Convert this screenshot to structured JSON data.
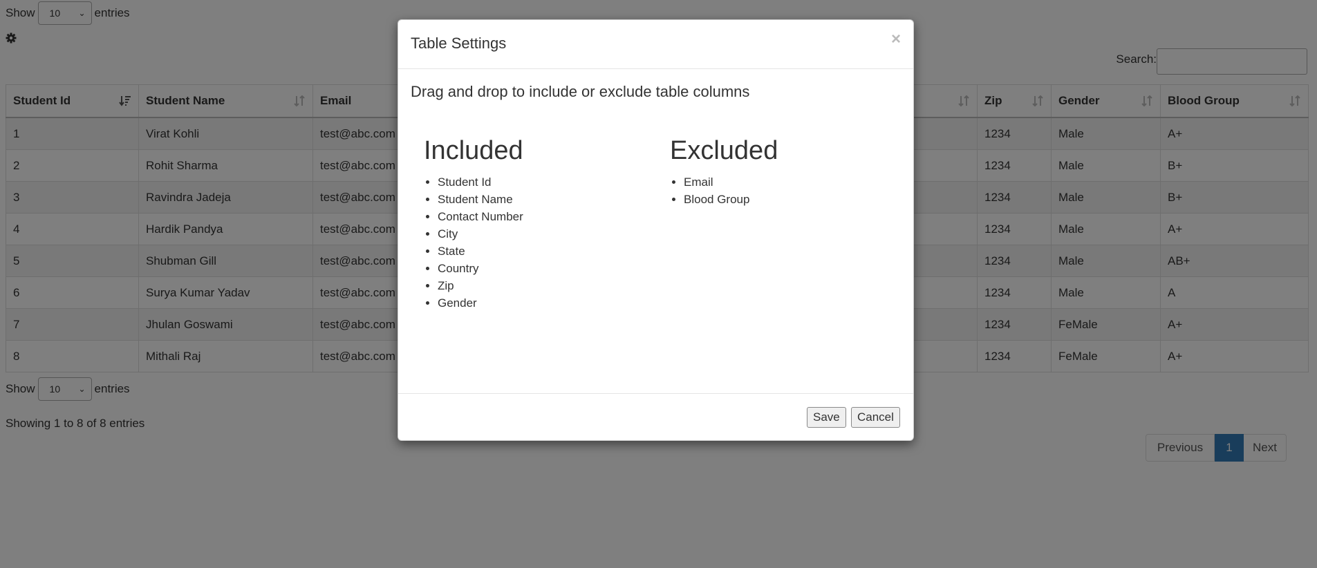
{
  "length_top": {
    "show": "Show",
    "value": "10",
    "entries": "entries"
  },
  "length_bottom": {
    "show": "Show",
    "value": "10",
    "entries": "entries"
  },
  "search": {
    "label": "Search:",
    "value": ""
  },
  "table": {
    "headers": [
      "Student Id",
      "Student Name",
      "Email",
      "",
      "",
      "",
      "",
      "Zip",
      "Gender",
      "Blood Group"
    ],
    "rows": [
      {
        "id": "1",
        "name": "Virat Kohli",
        "email": "test@abc.com",
        "zip": "1234",
        "gender": "Male",
        "blood": "A+"
      },
      {
        "id": "2",
        "name": "Rohit Sharma",
        "email": "test@abc.com",
        "zip": "1234",
        "gender": "Male",
        "blood": "B+"
      },
      {
        "id": "3",
        "name": "Ravindra Jadeja",
        "email": "test@abc.com",
        "zip": "1234",
        "gender": "Male",
        "blood": "B+"
      },
      {
        "id": "4",
        "name": "Hardik Pandya",
        "email": "test@abc.com",
        "zip": "1234",
        "gender": "Male",
        "blood": "A+"
      },
      {
        "id": "5",
        "name": "Shubman Gill",
        "email": "test@abc.com",
        "zip": "1234",
        "gender": "Male",
        "blood": "AB+"
      },
      {
        "id": "6",
        "name": "Surya Kumar Yadav",
        "email": "test@abc.com",
        "zip": "1234",
        "gender": "Male",
        "blood": "A"
      },
      {
        "id": "7",
        "name": "Jhulan Goswami",
        "email": "test@abc.com",
        "zip": "1234",
        "gender": "FeMale",
        "blood": "A+"
      },
      {
        "id": "8",
        "name": "Mithali Raj",
        "email": "test@abc.com",
        "zip": "1234",
        "gender": "FeMale",
        "blood": "A+"
      }
    ]
  },
  "info": "Showing 1 to 8 of 8 entries",
  "pagination": {
    "previous": "Previous",
    "current": "1",
    "next": "Next"
  },
  "modal": {
    "title": "Table Settings",
    "close": "×",
    "intro": "Drag and drop to include or exclude table columns",
    "included_title": "Included",
    "included": [
      "Student Id",
      "Student Name",
      "Contact Number",
      "City",
      "State",
      "Country",
      "Zip",
      "Gender"
    ],
    "excluded_title": "Excluded",
    "excluded": [
      "Email",
      "Blood Group"
    ],
    "save": "Save",
    "cancel": "Cancel"
  },
  "colors": {
    "pagination_active": "#337ab7",
    "backdrop": "rgba(0,0,0,0.5)"
  }
}
